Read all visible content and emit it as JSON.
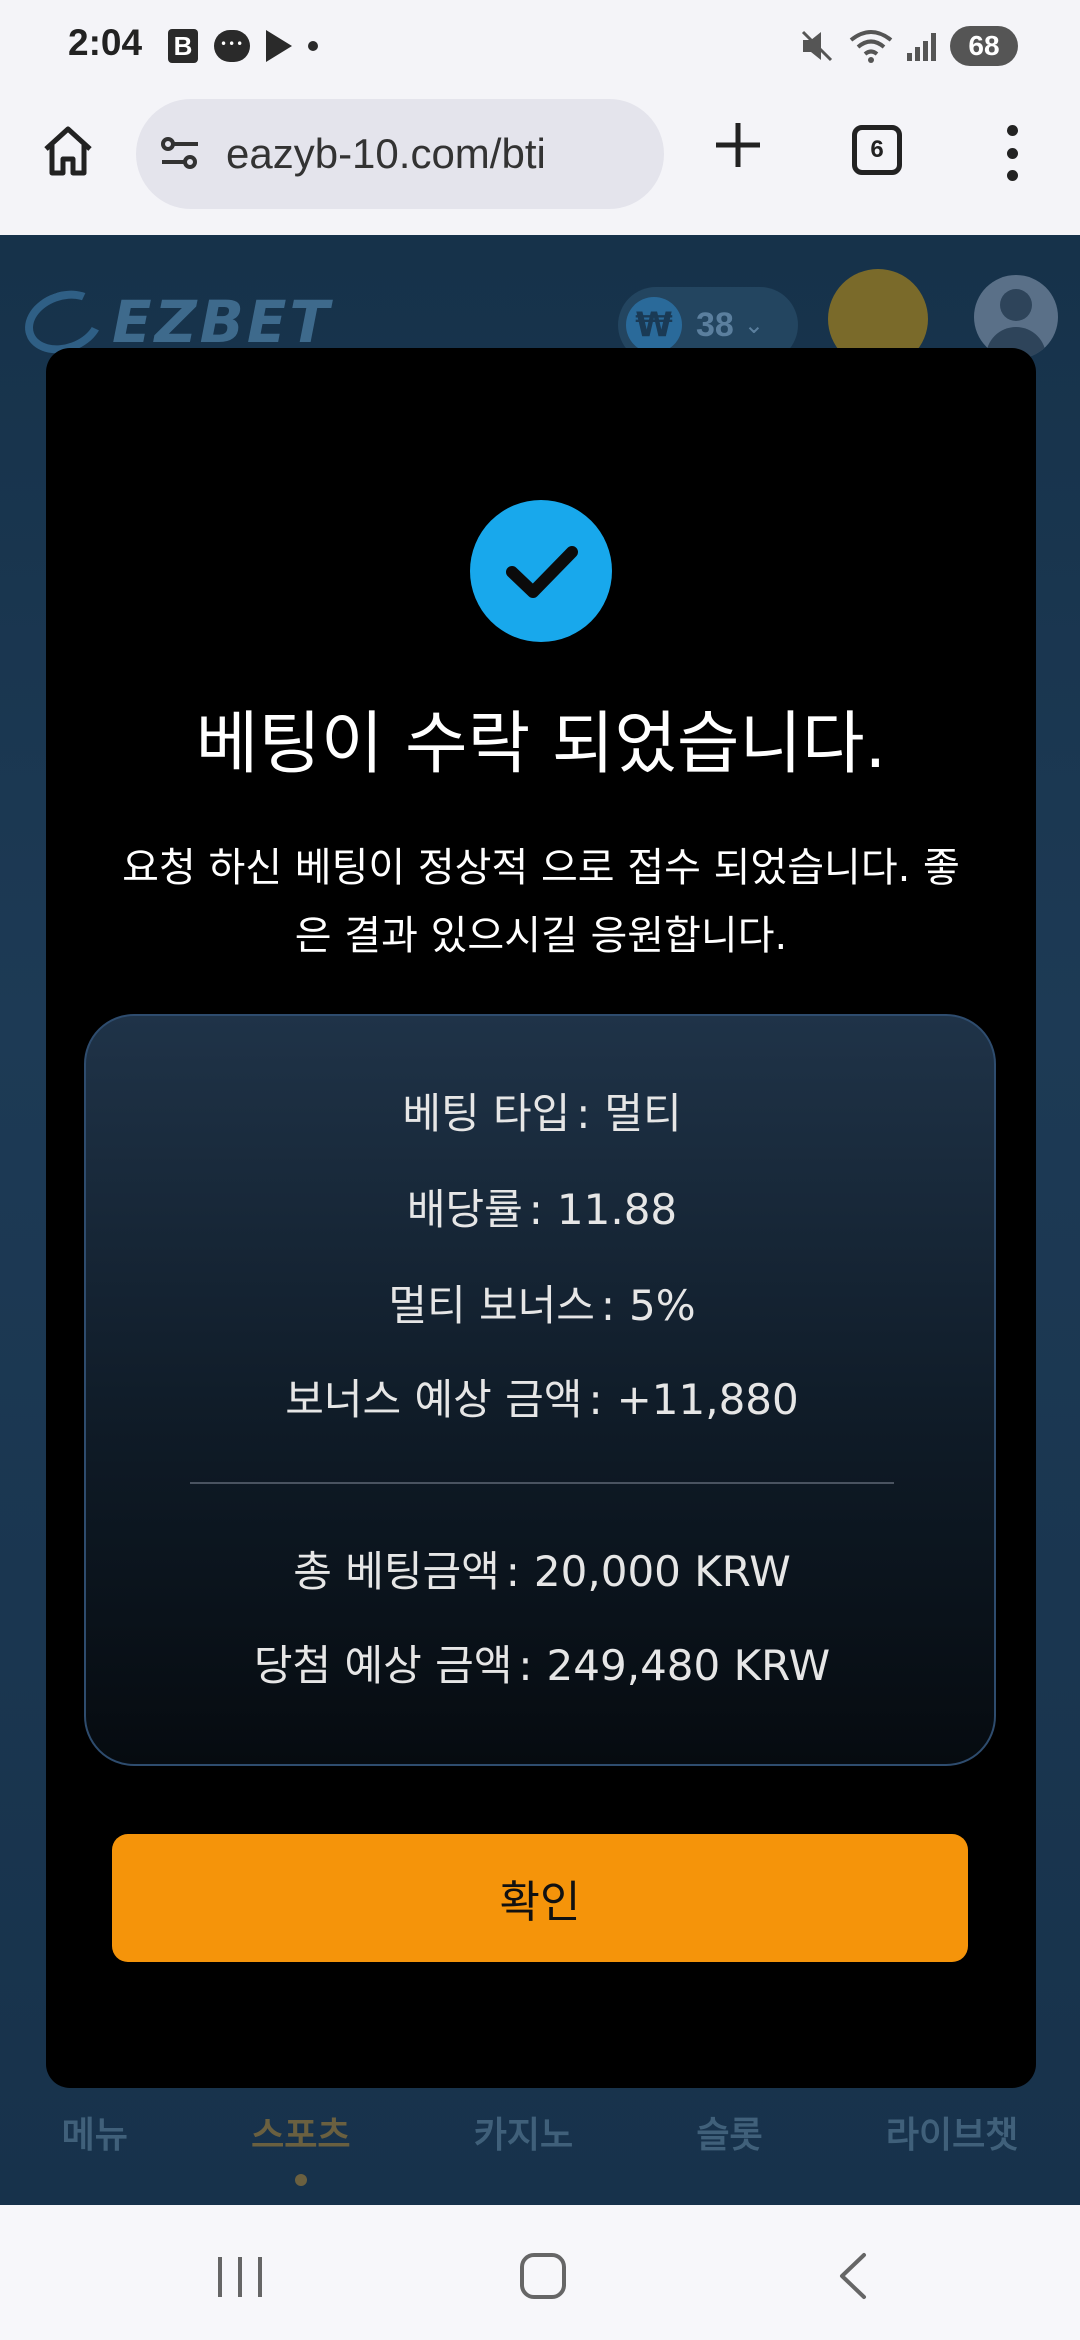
{
  "status_bar": {
    "time": "2:04",
    "left_icons": [
      "b-app-icon",
      "chat-bubble-icon",
      "play-store-icon",
      "dot-icon"
    ],
    "battery": "68",
    "right_icons": [
      "mute-vibrate-icon",
      "wifi-icon",
      "signal-icon",
      "battery-icon"
    ]
  },
  "browser": {
    "url": "eazyb-10.com/bti",
    "tab_count": "6",
    "icons": [
      "home-icon",
      "site-settings-icon",
      "new-tab-icon",
      "tab-switcher-icon",
      "more-options-icon"
    ]
  },
  "site": {
    "logo_text": "EZBET",
    "currency_symbol": "₩",
    "balance": "38",
    "nav": [
      {
        "label": "메뉴"
      },
      {
        "label": "스포츠"
      },
      {
        "label": "카지노"
      },
      {
        "label": "슬롯"
      },
      {
        "label": "라이브챗"
      }
    ],
    "active_nav_index": 1
  },
  "modal": {
    "title": "베팅이 수락 되었습니다.",
    "message": "요청 하신 베팅이 정상적 으로 접수 되었습니다. 좋은 결과 있으시길 응원합니다.",
    "summary": {
      "bet_type": {
        "label": "베팅 타입",
        "value": "멀티"
      },
      "odds": {
        "label": "배당률",
        "value": "11.88"
      },
      "multi_bonus": {
        "label": "멀티 보너스",
        "value": "5%"
      },
      "expected_bonus": {
        "label": "보너스 예상 금액",
        "value": "+11,880"
      },
      "total_stake": {
        "label": "총 베팅금액",
        "value": "20,000 KRW"
      },
      "expected_win": {
        "label": "당첨 예상 금액",
        "value": "249,480 KRW"
      }
    },
    "confirm_label": "확인"
  },
  "colors": {
    "accent_blue": "#18a8ec",
    "confirm_orange": "#f5940a",
    "modal_bg": "#000000",
    "site_bg": "#17324b"
  }
}
